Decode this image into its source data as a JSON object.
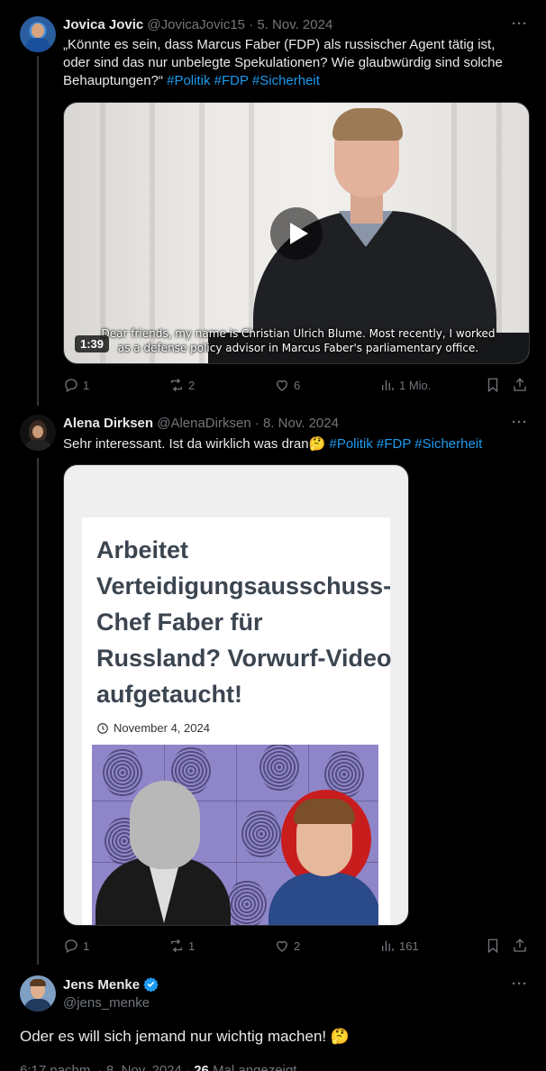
{
  "tweets": [
    {
      "name": "Jovica Jovic",
      "handle": "@JovicaJovic15",
      "date": "5. Nov. 2024",
      "text": "„Könnte es sein, dass Marcus Faber (FDP) als russischer Agent tätig ist, oder sind das nur unbelegte Spekulationen? Wie glaubwürdig sind solche Behauptungen?“",
      "hashtags": [
        "#Politik",
        "#FDP",
        "#Sicherheit"
      ],
      "video": {
        "duration": "1:39",
        "subtitle_line1": "Dear friends, my name is Christian Ulrich Blume. Most recently, I worked",
        "subtitle_line2": "as a defense policy advisor in Marcus Faber's parliamentary office."
      },
      "stats": {
        "replies": "1",
        "reposts": "2",
        "likes": "6",
        "views": "1 Mio."
      }
    },
    {
      "name": "Alena Dirksen",
      "handle": "@AlenaDirksen",
      "date": "8. Nov. 2024",
      "text": "Sehr interessant. Ist da wirklich was dran",
      "emoji": "🤔",
      "hashtags": [
        "#Politik",
        "#FDP",
        "#Sicherheit"
      ],
      "card": {
        "title": "Arbeitet Verteidigungsausschuss-Chef Faber für Russland? Vorwurf-Video aufgetaucht!",
        "date": "November 4, 2024"
      },
      "stats": {
        "replies": "1",
        "reposts": "1",
        "likes": "2",
        "views": "161"
      }
    },
    {
      "name": "Jens Menke",
      "handle": "@jens_menke",
      "verified": true,
      "text": "Oder es will sich jemand nur wichtig machen!",
      "emoji": "🤔",
      "footer_time": "6:17 nachm.",
      "footer_date": "8. Nov. 2024",
      "footer_views_count": "26",
      "footer_views_label": "Mal angezeigt"
    }
  ],
  "more_label": "···",
  "separator": "·",
  "colors": {
    "accent": "#1d9bf0",
    "muted": "#71767b",
    "bg": "#000000"
  }
}
